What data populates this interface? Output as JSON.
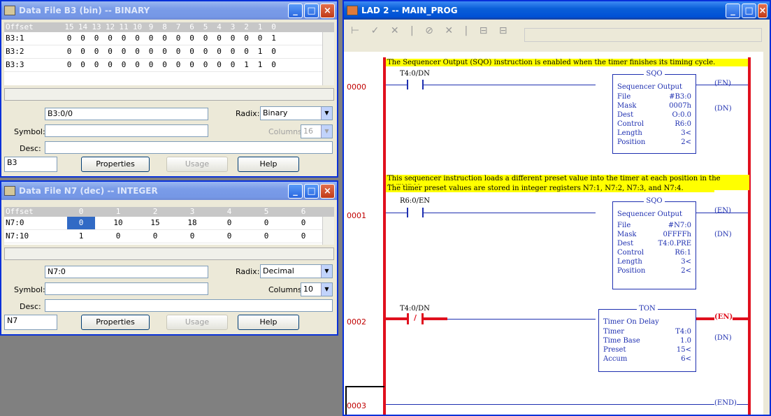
{
  "b3": {
    "title": "Data File B3 (bin)  --  BINARY",
    "header_offset": "Offset",
    "header_bits": [
      "15",
      "14",
      "13",
      "12",
      "11",
      "10",
      "9",
      "8",
      "7",
      "6",
      "5",
      "4",
      "3",
      "2",
      "1",
      "0"
    ],
    "rows": [
      {
        "label": "B3:1",
        "bits": [
          "0",
          "0",
          "0",
          "0",
          "0",
          "0",
          "0",
          "0",
          "0",
          "0",
          "0",
          "0",
          "0",
          "0",
          "0",
          "1"
        ]
      },
      {
        "label": "B3:2",
        "bits": [
          "0",
          "0",
          "0",
          "0",
          "0",
          "0",
          "0",
          "0",
          "0",
          "0",
          "0",
          "0",
          "0",
          "0",
          "1",
          "0"
        ]
      },
      {
        "label": "B3:3",
        "bits": [
          "0",
          "0",
          "0",
          "0",
          "0",
          "0",
          "0",
          "0",
          "0",
          "0",
          "0",
          "0",
          "0",
          "1",
          "1",
          "0"
        ]
      }
    ],
    "address": "B3:0/0",
    "radix_label": "Radix:",
    "radix": "Binary",
    "symbol_label": "Symbol:",
    "columns_label": "Columns:",
    "columns": "16",
    "desc_label": "Desc:",
    "file": "B3",
    "properties": "Properties",
    "usage": "Usage",
    "help": "Help"
  },
  "n7": {
    "title": "Data File N7 (dec)  --  INTEGER",
    "header_offset": "Offset",
    "header_cols": [
      "0",
      "1",
      "2",
      "3",
      "4",
      "5",
      "6"
    ],
    "rows": [
      {
        "label": "N7:0",
        "vals": [
          "0",
          "10",
          "15",
          "18",
          "0",
          "0",
          "0"
        ]
      },
      {
        "label": "N7:10",
        "vals": [
          "1",
          "0",
          "0",
          "0",
          "0",
          "0",
          "0"
        ]
      }
    ],
    "address": "N7:0",
    "radix_label": "Radix:",
    "radix": "Decimal",
    "symbol_label": "Symbol:",
    "columns_label": "Columns:",
    "columns": "10",
    "desc_label": "Desc:",
    "file": "N7",
    "properties": "Properties",
    "usage": "Usage",
    "help": "Help"
  },
  "lad": {
    "title": "LAD 2 -- MAIN_PROG",
    "rungs": {
      "r0": {
        "num": "0000",
        "comment": "The Sequencer Output (SQO) instruction is enabled when the timer finishes its timing cycle.",
        "contact": "T4:0/DN"
      },
      "r1": {
        "num": "0001",
        "comment1": "This sequencer instruction loads a different preset value into the timer at each position in the sequence.",
        "comment2": " The timer preset values are stored in integer registers N7:1, N7:2, N7:3, and N7:4.",
        "contact": "R6:0/EN"
      },
      "r2": {
        "num": "0002",
        "contact": "T4:0/DN"
      },
      "r3": {
        "num": "0003"
      }
    },
    "sqo1": {
      "name": "SQO",
      "desc": "Sequencer Output",
      "rows": [
        [
          "File",
          "#B3:0"
        ],
        [
          "Mask",
          "0007h"
        ],
        [
          "Dest",
          "O:0.0"
        ],
        [
          "Control",
          "R6:0"
        ],
        [
          "Length",
          "3<"
        ],
        [
          "Position",
          "2<"
        ]
      ]
    },
    "sqo2": {
      "name": "SQO",
      "desc": "Sequencer Output",
      "rows": [
        [
          "File",
          "#N7:0"
        ],
        [
          "Mask",
          "0FFFFh"
        ],
        [
          "Dest",
          "T4:0.PRE"
        ],
        [
          "Control",
          "R6:1"
        ],
        [
          "Length",
          "3<"
        ],
        [
          "Position",
          "2<"
        ]
      ]
    },
    "ton": {
      "name": "TON",
      "desc": "Timer On Delay",
      "rows": [
        [
          "Timer",
          "T4:0"
        ],
        [
          "Time Base",
          "1.0"
        ],
        [
          "Preset",
          "15<"
        ],
        [
          "Accum",
          "6<"
        ]
      ]
    },
    "coils": {
      "en": "EN",
      "dn": "DN",
      "end": "END"
    }
  }
}
